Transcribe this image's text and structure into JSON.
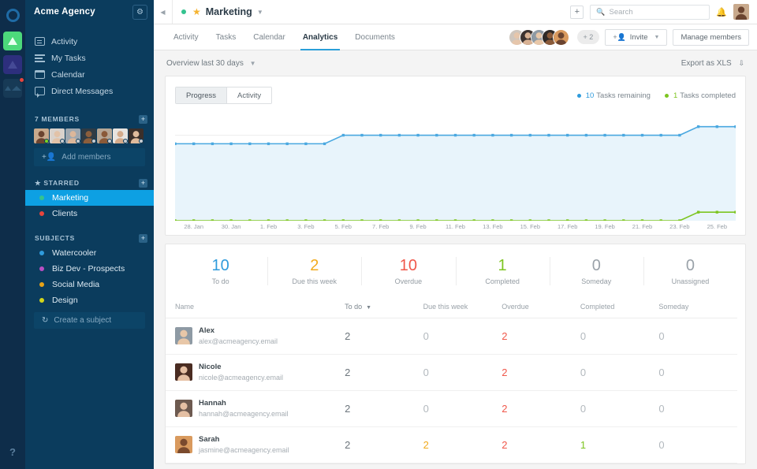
{
  "rail": {
    "logo_icon": "circle-logo-icon",
    "tiles": [
      {
        "name": "app-tile-green",
        "badge": false
      },
      {
        "name": "app-tile-purple",
        "badge": false
      },
      {
        "name": "app-tile-dark",
        "badge": true
      }
    ],
    "help_label": "?"
  },
  "sidebar": {
    "workspace": "Acme Agency",
    "settings_icon": "gear-icon",
    "nav": [
      {
        "label": "Activity",
        "icon": "activity-icon"
      },
      {
        "label": "My Tasks",
        "icon": "tasks-icon"
      },
      {
        "label": "Calendar",
        "icon": "calendar-icon"
      },
      {
        "label": "Direct Messages",
        "icon": "message-icon"
      }
    ],
    "members": {
      "title": "7 MEMBERS",
      "add_label": "Add members",
      "add_icon": "add-person-icon",
      "avatars": [
        {
          "skin": "#6b4430",
          "bg": "#c8a98c",
          "status": "#7ed321"
        },
        {
          "skin": "#e2c2a8",
          "bg": "#d9d2cc",
          "status": "#c9cdd1"
        },
        {
          "skin": "#dcb79a",
          "bg": "#9fa8b0",
          "status": "#c9cdd1"
        },
        {
          "skin": "#8b5e3c",
          "bg": "#2f3b44",
          "status": "#c9cdd1"
        },
        {
          "skin": "#8a5a39",
          "bg": "#b6a796",
          "status": "#c9cdd1"
        },
        {
          "skin": "#d4ab8b",
          "bg": "#e8e4df",
          "status": "#c9cdd1"
        },
        {
          "skin": "#e0bb9c",
          "bg": "#3b2f2a",
          "status": "#c9cdd1"
        }
      ]
    },
    "starred": {
      "title": "STARRED",
      "star_icon": "star-icon",
      "add_icon": "plus-icon",
      "items": [
        {
          "label": "Marketing",
          "color": "#34c38f",
          "active": true
        },
        {
          "label": "Clients",
          "color": "#e8453c",
          "active": false
        }
      ]
    },
    "subjects": {
      "title": "SUBJECTS",
      "add_icon": "plus-icon",
      "items": [
        {
          "label": "Watercooler",
          "color": "#2f9bdc"
        },
        {
          "label": "Biz Dev - Prospects",
          "color": "#b84fc4"
        },
        {
          "label": "Social Media",
          "color": "#e8a317"
        },
        {
          "label": "Design",
          "color": "#d3d61b"
        }
      ],
      "create_label": "Create a subject",
      "create_icon": "refresh-icon"
    }
  },
  "topbar": {
    "back_icon": "chevron-left-icon",
    "project_dot_color": "#34c38f",
    "star_icon": "star-icon",
    "project_name": "Marketing",
    "project_caret_icon": "chevron-down-icon",
    "plus_icon": "plus-icon",
    "search": {
      "placeholder": "Search",
      "icon": "search-icon"
    },
    "bell_icon": "bell-icon",
    "avatar_name": "user-avatar"
  },
  "tabs": [
    {
      "label": "Activity",
      "active": false
    },
    {
      "label": "Tasks",
      "active": false
    },
    {
      "label": "Calendar",
      "active": false
    },
    {
      "label": "Analytics",
      "active": true
    },
    {
      "label": "Documents",
      "active": false
    }
  ],
  "tabbar_right": {
    "avatars": [
      {
        "skin": "#e6c6ab",
        "bg": "#cfc6bd"
      },
      {
        "skin": "#d8b193",
        "bg": "#3c3330"
      },
      {
        "skin": "#e8c7a8",
        "bg": "#8e9aa4"
      },
      {
        "skin": "#8a5a39",
        "bg": "#2f2a27"
      },
      {
        "skin": "#6b4430",
        "bg": "#d99a5e"
      }
    ],
    "more_label": "+ 2",
    "invite_label": "Invite",
    "invite_icon": "add-person-icon",
    "invite_caret_icon": "chevron-down-icon",
    "manage_label": "Manage members"
  },
  "overview": {
    "range_label": "Overview last 30 days",
    "range_caret_icon": "chevron-down-icon",
    "export_label": "Export as XLS",
    "export_icon": "download-icon"
  },
  "chart_toggle": [
    {
      "label": "Progress",
      "active": true
    },
    {
      "label": "Activity",
      "active": false
    }
  ],
  "chart_legend": [
    {
      "value": "10",
      "label": "Tasks remaining",
      "color": "#2f9bdc"
    },
    {
      "value": "1",
      "label": "Tasks completed",
      "color": "#7dc520"
    }
  ],
  "chart_data": {
    "type": "area",
    "title": "Overview last 30 days",
    "xlabel": "",
    "ylabel": "",
    "ylim": [
      0,
      13
    ],
    "grid": true,
    "legend_position": "top-right",
    "x": [
      "27. Jan",
      "28. Jan",
      "29. Jan",
      "30. Jan",
      "31. Jan",
      "1. Feb",
      "2. Feb",
      "3. Feb",
      "4. Feb",
      "5. Feb",
      "6. Feb",
      "7. Feb",
      "8. Feb",
      "9. Feb",
      "10. Feb",
      "11. Feb",
      "12. Feb",
      "13. Feb",
      "14. Feb",
      "15. Feb",
      "16. Feb",
      "17. Feb",
      "18. Feb",
      "19. Feb",
      "20. Feb",
      "21. Feb",
      "22. Feb",
      "23. Feb",
      "24. Feb",
      "25. Feb",
      "26. Feb"
    ],
    "tick_labels": [
      "28. Jan",
      "30. Jan",
      "1. Feb",
      "3. Feb",
      "5. Feb",
      "7. Feb",
      "9. Feb",
      "11. Feb",
      "13. Feb",
      "15. Feb",
      "17. Feb",
      "19. Feb",
      "21. Feb",
      "23. Feb",
      "25. Feb"
    ],
    "series": [
      {
        "name": "Tasks remaining",
        "color": "#4aa8e0",
        "fill": "#e8f4fb",
        "values": [
          9,
          9,
          9,
          9,
          9,
          9,
          9,
          9,
          9,
          10,
          10,
          10,
          10,
          10,
          10,
          10,
          10,
          10,
          10,
          10,
          10,
          10,
          10,
          10,
          10,
          10,
          10,
          10,
          11,
          11,
          11
        ]
      },
      {
        "name": "Tasks completed",
        "color": "#7dc520",
        "fill": "#eef6e2",
        "values": [
          0,
          0,
          0,
          0,
          0,
          0,
          0,
          0,
          0,
          0,
          0,
          0,
          0,
          0,
          0,
          0,
          0,
          0,
          0,
          0,
          0,
          0,
          0,
          0,
          0,
          0,
          0,
          0,
          1,
          1,
          1
        ]
      }
    ]
  },
  "stats": [
    {
      "value": "10",
      "label": "To do",
      "color": "#2f9bdc"
    },
    {
      "value": "2",
      "label": "Due this week",
      "color": "#f2ab1e"
    },
    {
      "value": "10",
      "label": "Overdue",
      "color": "#f0584b"
    },
    {
      "value": "1",
      "label": "Completed",
      "color": "#7dc520"
    },
    {
      "value": "0",
      "label": "Someday",
      "color": "#9aa2a9"
    },
    {
      "value": "0",
      "label": "Unassigned",
      "color": "#9aa2a9"
    }
  ],
  "table": {
    "columns": [
      {
        "label": "Name",
        "sorted": false
      },
      {
        "label": "To do",
        "sorted": true,
        "sort_icon": "sort-desc-icon"
      },
      {
        "label": "Due this week",
        "sorted": false
      },
      {
        "label": "Overdue",
        "sorted": false
      },
      {
        "label": "Completed",
        "sorted": false
      },
      {
        "label": "Someday",
        "sorted": false
      }
    ],
    "rows": [
      {
        "name": "Alex",
        "email": "alex@acmeagency.email",
        "avatar": {
          "skin": "#e8c7a8",
          "bg": "#8e9aa4"
        },
        "todo": "2",
        "due": "0",
        "overdue": "2",
        "completed": "0",
        "someday": "0",
        "due_tone": "zero",
        "overdue_tone": "red",
        "completed_tone": "zero",
        "someday_tone": "zero"
      },
      {
        "name": "Nicole",
        "email": "nicole@acmeagency.email",
        "avatar": {
          "skin": "#e6c0a4",
          "bg": "#4a2c22"
        },
        "todo": "2",
        "due": "0",
        "overdue": "2",
        "completed": "0",
        "someday": "0",
        "due_tone": "zero",
        "overdue_tone": "red",
        "completed_tone": "zero",
        "someday_tone": "zero"
      },
      {
        "name": "Hannah",
        "email": "hannah@acmeagency.email",
        "avatar": {
          "skin": "#e4bfa3",
          "bg": "#6d5a50"
        },
        "todo": "2",
        "due": "0",
        "overdue": "2",
        "completed": "0",
        "someday": "0",
        "due_tone": "zero",
        "overdue_tone": "red",
        "completed_tone": "zero",
        "someday_tone": "zero"
      },
      {
        "name": "Sarah",
        "email": "jasmine@acmeagency.email",
        "avatar": {
          "skin": "#7a4a2e",
          "bg": "#d99a5e"
        },
        "todo": "2",
        "due": "2",
        "overdue": "2",
        "completed": "1",
        "someday": "0",
        "due_tone": "amber",
        "overdue_tone": "red",
        "completed_tone": "green",
        "someday_tone": "zero"
      }
    ]
  }
}
